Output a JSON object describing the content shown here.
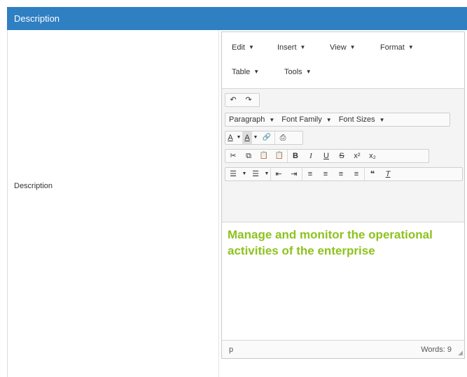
{
  "header": {
    "title": "Description"
  },
  "field": {
    "label": "Description"
  },
  "menubar": {
    "edit": "Edit",
    "insert": "Insert",
    "view": "View",
    "format": "Format",
    "table": "Table",
    "tools": "Tools",
    "caret": "▼"
  },
  "toolbar": {
    "undo": "↶",
    "redo": "↷",
    "paragraph": "Paragraph",
    "font_family": "Font Family",
    "font_sizes": "Font Sizes",
    "text_color": "A",
    "bg_color": "A",
    "link": "🔗",
    "print": "⎙",
    "cut": "✂",
    "copy": "⧉",
    "paste": "📋",
    "paste_text": "📋",
    "bold": "B",
    "italic": "I",
    "underline": "U",
    "strike": "S",
    "superscript": "x²",
    "subscript": "x₂",
    "bullet_list": "☰",
    "numbered_list": "☰",
    "outdent": "⇤",
    "indent": "⇥",
    "align_left": "≡",
    "align_center": "≡",
    "align_right": "≡",
    "justify": "≡",
    "blockquote": "❝",
    "clear_format": "T"
  },
  "content": {
    "text": "Manage and monitor the operational activities of the enterprise"
  },
  "statusbar": {
    "path": "p",
    "words": "Words: 9",
    "grip": "◢"
  }
}
